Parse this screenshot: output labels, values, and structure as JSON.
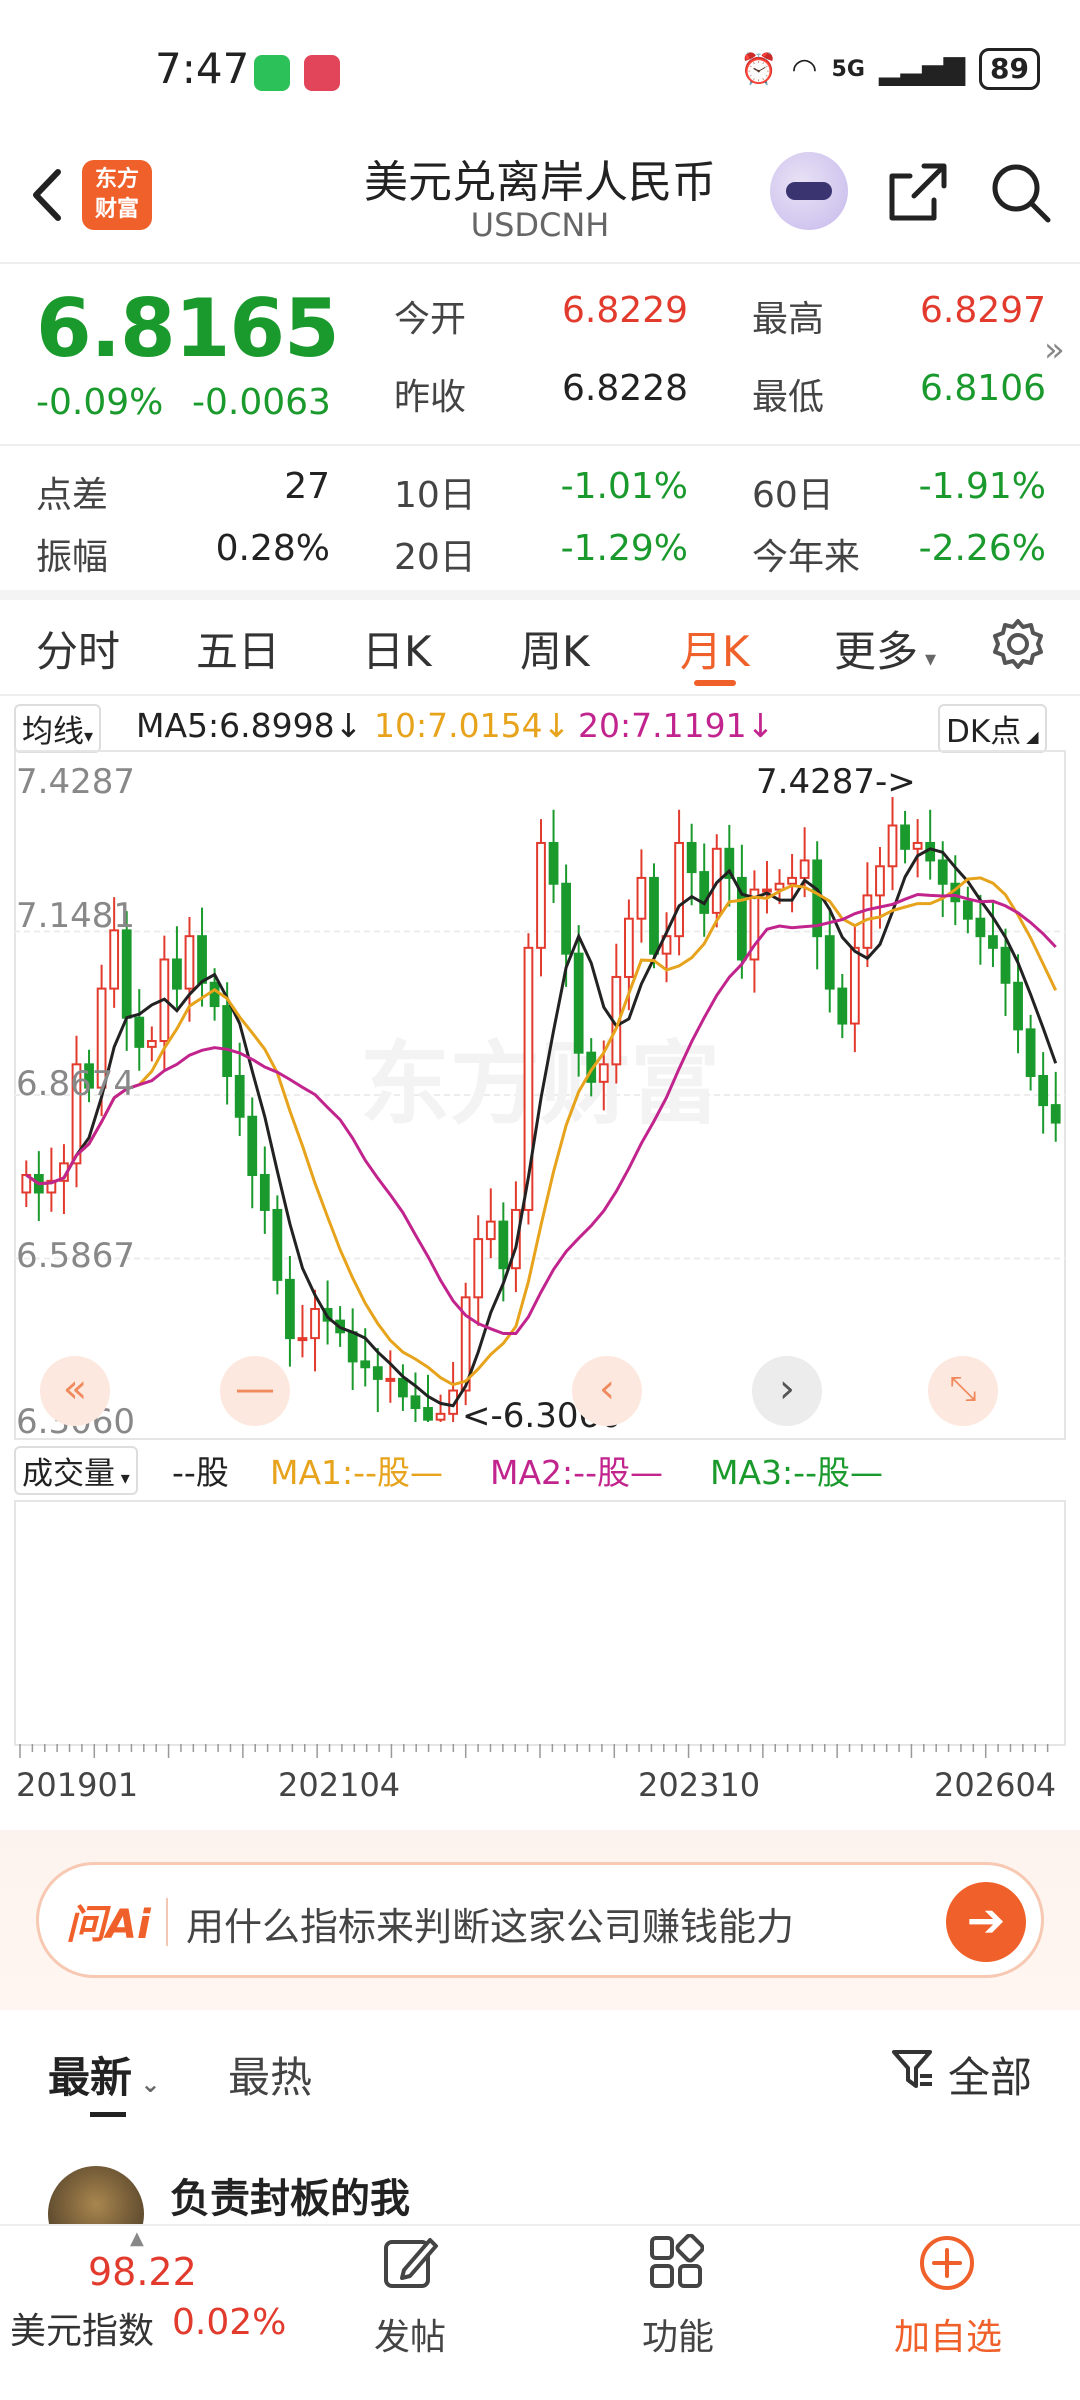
{
  "status_bar": {
    "time": "7:47",
    "signal": "5G",
    "battery": "89"
  },
  "header": {
    "logo_text": "东方财富",
    "title": "美元兑离岸人民币",
    "subtitle": "USDCNH"
  },
  "quote": {
    "price": "6.8165",
    "change_pct": "-0.09%",
    "change": "-0.0063",
    "open_label": "今开",
    "open": "6.8229",
    "high_label": "最高",
    "high": "6.8297",
    "prev_close_label": "昨收",
    "prev_close": "6.8228",
    "low_label": "最低",
    "low": "6.8106",
    "spread_label": "点差",
    "spread": "27",
    "d10_label": "10日",
    "d10": "-1.01%",
    "d60_label": "60日",
    "d60": "-1.91%",
    "amp_label": "振幅",
    "amp": "0.28%",
    "d20_label": "20日",
    "d20": "-1.29%",
    "ytd_label": "今年来",
    "ytd": "-2.26%"
  },
  "tabs": [
    "分时",
    "五日",
    "日K",
    "周K",
    "月K",
    "更多"
  ],
  "active_tab": "月K",
  "ma_header": {
    "selector": "均线",
    "ma5": "MA5:6.8998↓",
    "ma10": "10:7.0154↓",
    "ma20": "20:7.1191↓",
    "dk": "DK点"
  },
  "colors": {
    "accent": "#f0602a",
    "up": "#e23b2e",
    "down": "#1a9a2c",
    "ma5": "#222222",
    "ma10": "#e6a31b",
    "ma20": "#c2248e"
  },
  "chart_data": {
    "type": "candlestick",
    "y_ticks": [
      "7.4287",
      "7.1481",
      "6.8674",
      "6.5867",
      "6.3060"
    ],
    "ylim": [
      6.306,
      7.4287
    ],
    "x_ticks": [
      "201901",
      "202104",
      "202310",
      "202604"
    ],
    "annotations": {
      "max_label": "7.4287->",
      "min_label": "<-6.3060"
    },
    "close": [
      6.73,
      6.7,
      6.72,
      6.75,
      6.92,
      6.88,
      7.05,
      7.15,
      7.0,
      6.95,
      6.96,
      7.1,
      7.05,
      7.14,
      7.06,
      7.02,
      6.9,
      6.83,
      6.73,
      6.67,
      6.55,
      6.45,
      6.45,
      6.5,
      6.48,
      6.46,
      6.41,
      6.4,
      6.38,
      6.38,
      6.35,
      6.33,
      6.31,
      6.32,
      6.36,
      6.52,
      6.62,
      6.65,
      6.57,
      6.67,
      7.12,
      7.3,
      7.23,
      7.11,
      6.94,
      6.89,
      6.92,
      7.07,
      7.17,
      7.24,
      7.11,
      7.14,
      7.3,
      7.25,
      7.18,
      7.29,
      7.24,
      7.1,
      7.22,
      7.22,
      7.23,
      7.24,
      7.27,
      7.14,
      7.05,
      6.99,
      7.12,
      7.21,
      7.26,
      7.33,
      7.29,
      7.3,
      7.27,
      7.23,
      7.2,
      7.17,
      7.14,
      7.12,
      7.06,
      6.98,
      6.9,
      6.85,
      6.82
    ],
    "ma_series": [
      "MA5",
      "MA10",
      "MA20"
    ]
  },
  "volume": {
    "selector": "成交量",
    "unit": "--股",
    "ma1": "MA1:--股—",
    "ma2": "MA2:--股—",
    "ma3": "MA3:--股—"
  },
  "ai": {
    "logo": "问Ai",
    "prompt": "用什么指标来判断这家公司赚钱能力"
  },
  "news_tabs": {
    "latest": "最新",
    "hot": "最热",
    "filter": "全部"
  },
  "post": {
    "author": "负责封板的我"
  },
  "bottom_nav": {
    "index_value": "98.22",
    "index_name": "美元指数",
    "index_change": "0.02%",
    "post": "发帖",
    "functions": "功能",
    "add_watch": "加自选"
  }
}
